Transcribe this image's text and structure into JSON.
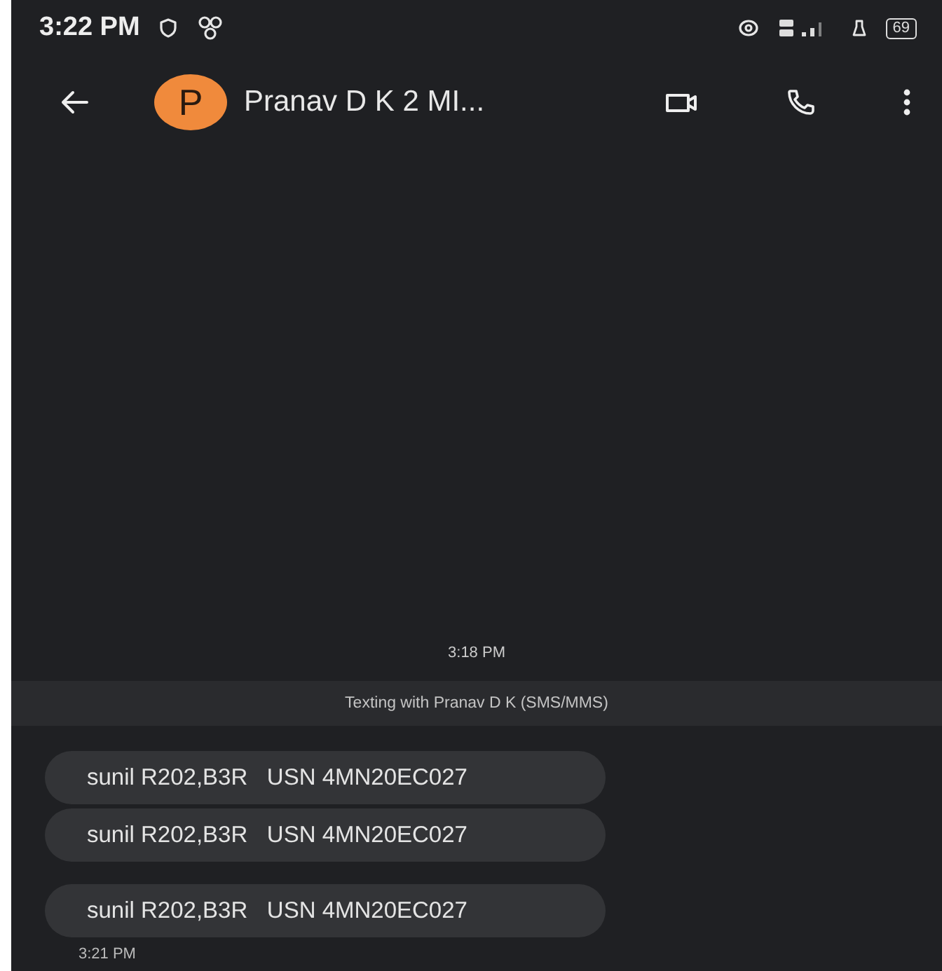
{
  "status_bar": {
    "time": "3:22 PM",
    "battery": "69"
  },
  "header": {
    "avatar_letter": "P",
    "title": "Pranav D K 2 MI..."
  },
  "conversation": {
    "date_time": "3:18 PM",
    "banner": "Texting with Pranav D K (SMS/MMS)",
    "groups": [
      {
        "messages": [
          "sunil R202,B3R   USN 4MN20EC027",
          "sunil R202,B3R   USN 4MN20EC027"
        ]
      },
      {
        "messages": [
          "sunil R202,B3R   USN 4MN20EC027"
        ],
        "time": "3:21 PM"
      }
    ]
  }
}
